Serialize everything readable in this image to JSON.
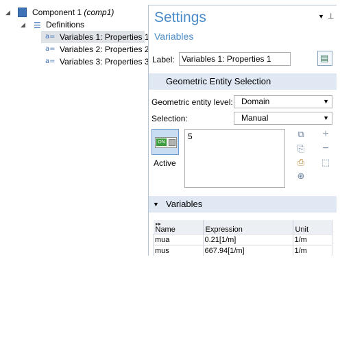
{
  "tree": {
    "component": {
      "label": "Component 1",
      "tag": "(comp1)"
    },
    "definitions": {
      "label": "Definitions"
    },
    "items": [
      {
        "icon": "a=",
        "label": "Variables 1: Properties 1"
      },
      {
        "icon": "a=",
        "label": "Variables 2: Properties 2"
      },
      {
        "icon": "a=",
        "label": "Variables 3: Properties 3"
      }
    ]
  },
  "settings": {
    "title": "Settings",
    "subtitle": "Variables",
    "label_caption": "Label:",
    "label_value": "Variables 1: Properties 1",
    "geo_section": "Geometric Entity Selection",
    "entity_level_caption": "Geometric entity level:",
    "entity_level_value": "Domain",
    "selection_caption": "Selection:",
    "selection_value": "Manual",
    "selected_domain": "5",
    "toggle_text": "ON",
    "active_label": "Active",
    "variables_section": "Variables"
  },
  "table": {
    "columns": [
      "Name",
      "Expression",
      "Unit"
    ],
    "rows": [
      {
        "name": "mua",
        "expression": "0.21[1/m]",
        "unit": "1/m"
      },
      {
        "name": "mus",
        "expression": "667.94[1/m]",
        "unit": "1/m"
      }
    ]
  },
  "colors": {
    "accent": "#4a8cc9",
    "section_bg": "#dfe8f3",
    "tree_selection": "#dfe3e8"
  }
}
